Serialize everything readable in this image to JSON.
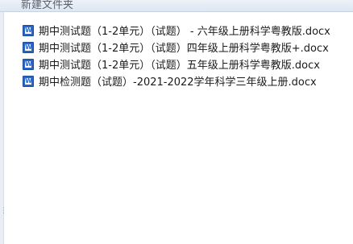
{
  "header": {
    "title": "新建文件夹"
  },
  "files": [
    {
      "name": "期中测试题（1-2单元）（试题） - 六年级上册科学粤教版.docx",
      "icon": "word-doc-icon"
    },
    {
      "name": "期中测试题（1-2单元）（试题）四年级上册科学粤教版+.docx",
      "icon": "word-doc-icon"
    },
    {
      "name": "期中测试题（1-2单元）（试题）五年级上册科学粤教版.docx",
      "icon": "word-doc-icon"
    },
    {
      "name": "期中检测题（试题）-2021-2022学年科学三年级上册.docx",
      "icon": "word-doc-icon"
    }
  ],
  "colors": {
    "word_icon": "#2b65c4",
    "header_bg": "#dde6f2"
  }
}
